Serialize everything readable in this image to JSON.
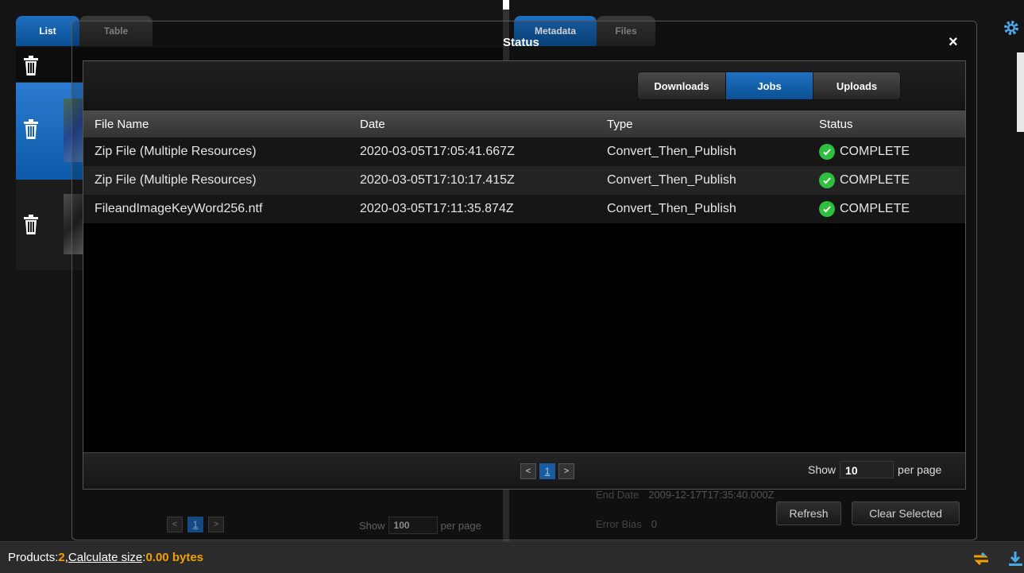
{
  "left_tabs": [
    {
      "label": "List",
      "active": true
    },
    {
      "label": "Table",
      "active": false
    }
  ],
  "right_tabs": [
    {
      "label": "Metadata",
      "active": true
    },
    {
      "label": "Files",
      "active": false
    }
  ],
  "left_pager": {
    "prev": "<",
    "page": "1",
    "next": ">",
    "show_label": "Show",
    "show_value": "100",
    "per_page_label": "per page"
  },
  "metadata": {
    "end_date_label": "End Date",
    "end_date_value": "2009-12-17T17:35:40.000Z",
    "error_bias_label": "Error Bias",
    "error_bias_value": "0"
  },
  "buttons": {
    "refresh": "Refresh",
    "clear_selected": "Clear Selected"
  },
  "modal": {
    "title": "Status",
    "close": "×",
    "segments": [
      {
        "label": "Downloads",
        "active": false
      },
      {
        "label": "Jobs",
        "active": true
      },
      {
        "label": "Uploads",
        "active": false
      }
    ],
    "columns": [
      "File Name",
      "Date",
      "Type",
      "Status"
    ],
    "rows": [
      {
        "file": "Zip File (Multiple Resources)",
        "date": "2020-03-05T17:05:41.667Z",
        "type": "Convert_Then_Publish",
        "status": "COMPLETE"
      },
      {
        "file": "Zip File (Multiple Resources)",
        "date": "2020-03-05T17:10:17.415Z",
        "type": "Convert_Then_Publish",
        "status": "COMPLETE"
      },
      {
        "file": "FileandImageKeyWord256.ntf",
        "date": "2020-03-05T17:11:35.874Z",
        "type": "Convert_Then_Publish",
        "status": "COMPLETE"
      }
    ],
    "pager": {
      "prev": "<",
      "page": "1",
      "next": ">",
      "show_label": "Show",
      "show_value": "10",
      "per_page_label": "per page"
    }
  },
  "statusbar": {
    "products_label": "Products: ",
    "products_count": "2",
    "separator": ", ",
    "calc_link": "Calculate size",
    "colon": ": ",
    "size_value": "0.00 bytes"
  },
  "colors": {
    "accent": "#0b5aa8",
    "complete": "#2fbf3f",
    "highlight": "#f0a000"
  }
}
